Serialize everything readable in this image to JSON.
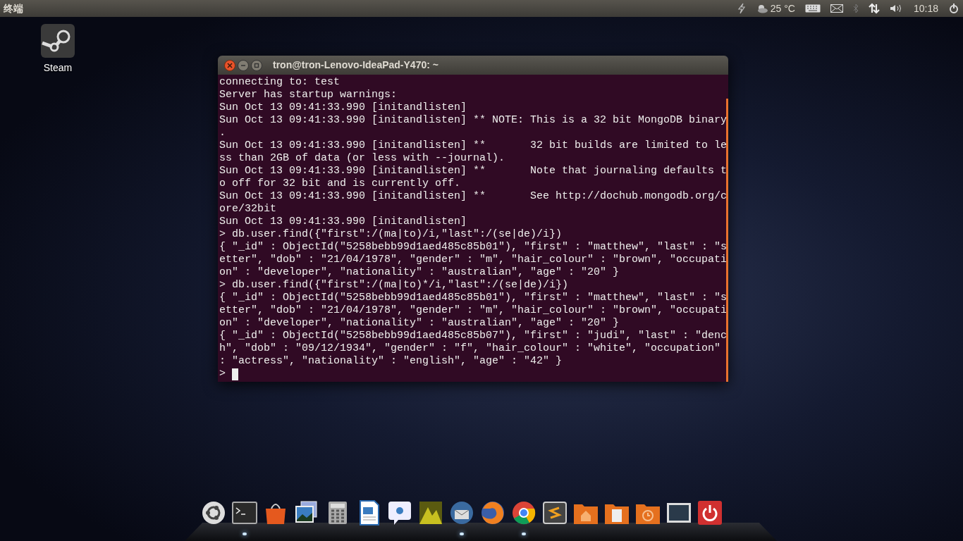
{
  "top_panel": {
    "app_title": "终端",
    "temperature": "25 °C",
    "time": "10:18"
  },
  "desktop_icons": [
    {
      "label": "Steam"
    }
  ],
  "terminal": {
    "title": "tron@tron-Lenovo-IdeaPad-Y470: ~",
    "lines": [
      "connecting to: test",
      "Server has startup warnings:",
      "Sun Oct 13 09:41:33.990 [initandlisten]",
      "Sun Oct 13 09:41:33.990 [initandlisten] ** NOTE: This is a 32 bit MongoDB binary",
      ".",
      "Sun Oct 13 09:41:33.990 [initandlisten] **       32 bit builds are limited to le",
      "ss than 2GB of data (or less with --journal).",
      "Sun Oct 13 09:41:33.990 [initandlisten] **       Note that journaling defaults t",
      "o off for 32 bit and is currently off.",
      "Sun Oct 13 09:41:33.990 [initandlisten] **       See http://dochub.mongodb.org/c",
      "ore/32bit",
      "Sun Oct 13 09:41:33.990 [initandlisten]",
      "> db.user.find({\"first\":/(ma|to)/i,\"last\":/(se|de)/i})",
      "{ \"_id\" : ObjectId(\"5258bebb99d1aed485c85b01\"), \"first\" : \"matthew\", \"last\" : \"s",
      "etter\", \"dob\" : \"21/04/1978\", \"gender\" : \"m\", \"hair_colour\" : \"brown\", \"occupati",
      "on\" : \"developer\", \"nationality\" : \"australian\", \"age\" : \"20\" }",
      "> db.user.find({\"first\":/(ma|to)*/i,\"last\":/(se|de)/i})",
      "{ \"_id\" : ObjectId(\"5258bebb99d1aed485c85b01\"), \"first\" : \"matthew\", \"last\" : \"s",
      "etter\", \"dob\" : \"21/04/1978\", \"gender\" : \"m\", \"hair_colour\" : \"brown\", \"occupati",
      "on\" : \"developer\", \"nationality\" : \"australian\", \"age\" : \"20\" }",
      "{ \"_id\" : ObjectId(\"5258bebb99d1aed485c85b07\"), \"first\" : \"judi\", \"last\" : \"denc",
      "h\", \"dob\" : \"09/12/1934\", \"gender\" : \"f\", \"hair_colour\" : \"white\", \"occupation\"",
      ": \"actress\", \"nationality\" : \"english\", \"age\" : \"42\" }"
    ],
    "prompt": ">"
  },
  "dock": [
    {
      "kind": "ubuntu",
      "running": false
    },
    {
      "kind": "terminal",
      "running": true
    },
    {
      "kind": "bag",
      "running": false
    },
    {
      "kind": "photos",
      "running": false
    },
    {
      "kind": "calculator",
      "running": false
    },
    {
      "kind": "document",
      "running": false
    },
    {
      "kind": "chat",
      "running": false
    },
    {
      "kind": "image",
      "running": false
    },
    {
      "kind": "mail",
      "running": true
    },
    {
      "kind": "firefox",
      "running": false
    },
    {
      "kind": "chrome",
      "running": true
    },
    {
      "kind": "editor",
      "running": false
    },
    {
      "kind": "home",
      "running": false
    },
    {
      "kind": "folder",
      "running": false
    },
    {
      "kind": "backup",
      "running": false
    },
    {
      "kind": "screen",
      "running": false
    },
    {
      "kind": "power",
      "running": false
    }
  ]
}
